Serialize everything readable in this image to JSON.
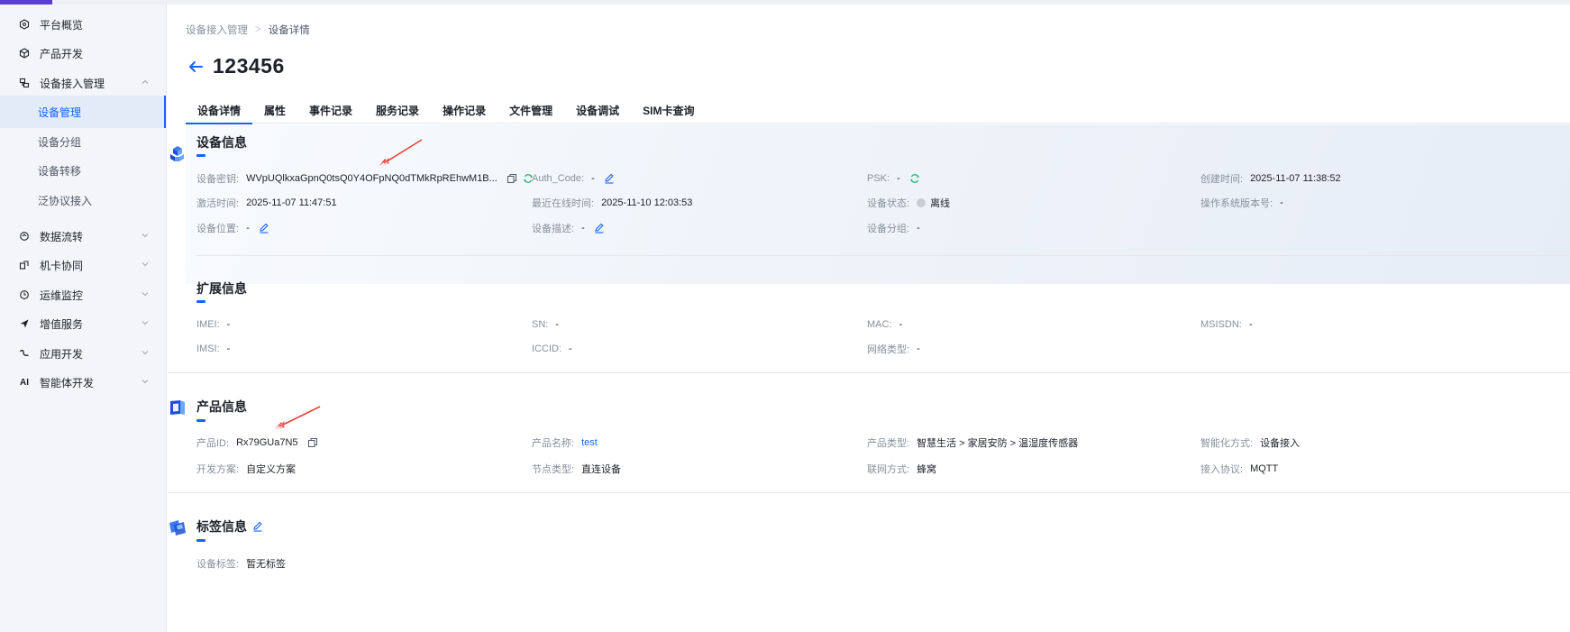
{
  "sidebar": {
    "items": [
      {
        "label": "平台概览"
      },
      {
        "label": "产品开发"
      },
      {
        "label": "设备接入管理"
      },
      {
        "label": "数据流转"
      },
      {
        "label": "机卡协同"
      },
      {
        "label": "运维监控"
      },
      {
        "label": "增值服务"
      },
      {
        "label": "应用开发"
      },
      {
        "label": "智能体开发",
        "icon_text": "AI"
      }
    ],
    "sub_items": [
      {
        "label": "设备管理",
        "active": true
      },
      {
        "label": "设备分组"
      },
      {
        "label": "设备转移"
      },
      {
        "label": "泛协议接入"
      }
    ]
  },
  "breadcrumb": {
    "parent": "设备接入管理",
    "separator": ">",
    "current": "设备详情"
  },
  "page": {
    "title": "123456"
  },
  "tabs": [
    "设备详情",
    "属性",
    "事件记录",
    "服务记录",
    "操作记录",
    "文件管理",
    "设备调试",
    "SIM卡查询"
  ],
  "device_info": {
    "title": "设备信息",
    "secret_label": "设备密钥:",
    "secret_value": "WVpUQlkxaGpnQ0tsQ0Y4OFpNQ0dTMkRpREhwM1B...",
    "auth_label": "Auth_Code:",
    "auth_value": "-",
    "psk_label": "PSK:",
    "psk_value": "-",
    "created_label": "创建时间:",
    "created_value": "2025-11-07 11:38:52",
    "activated_label": "激活时间:",
    "activated_value": "2025-11-07 11:47:51",
    "last_online_label": "最近在线时间:",
    "last_online_value": "2025-11-10 12:03:53",
    "status_label": "设备状态:",
    "status_value": "离线",
    "os_label": "操作系统版本号:",
    "os_value": "-",
    "location_label": "设备位置:",
    "location_value": "-",
    "desc_label": "设备描述:",
    "desc_value": "-",
    "group_label": "设备分组:",
    "group_value": "-"
  },
  "ext_info": {
    "title": "扩展信息",
    "imei_label": "IMEI:",
    "imei_value": "-",
    "sn_label": "SN:",
    "sn_value": "-",
    "mac_label": "MAC:",
    "mac_value": "-",
    "msisdn_label": "MSISDN:",
    "msisdn_value": "-",
    "imsi_label": "IMSI:",
    "imsi_value": "-",
    "iccid_label": "ICCID:",
    "iccid_value": "-",
    "net_label": "网络类型:",
    "net_value": "-"
  },
  "product_info": {
    "title": "产品信息",
    "pid_label": "产品ID:",
    "pid_value": "Rx79GUa7N5",
    "pname_label": "产品名称:",
    "pname_value": "test",
    "ptype_label": "产品类型:",
    "ptype_value": "智慧生活 > 家居安防 > 温湿度传感器",
    "smart_label": "智能化方式:",
    "smart_value": "设备接入",
    "dev_label": "开发方案:",
    "dev_value": "自定义方案",
    "node_label": "节点类型:",
    "node_value": "直连设备",
    "network_label": "联网方式:",
    "network_value": "蜂窝",
    "protocol_label": "接入协议:",
    "protocol_value": "MQTT"
  },
  "tag_info": {
    "title": "标签信息",
    "tag_label": "设备标签:",
    "tag_value": "暂无标签"
  },
  "colors": {
    "accent": "#1664ff",
    "annotation": "#e8423a",
    "brand": "#5b3fd1"
  }
}
